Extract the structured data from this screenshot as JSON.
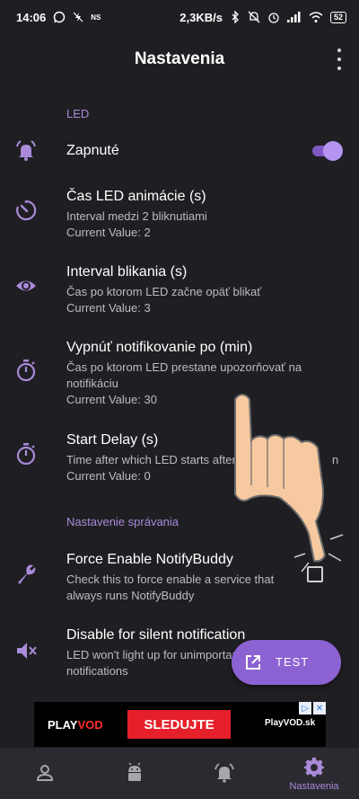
{
  "status_bar": {
    "time": "14:06",
    "left_small": "NS",
    "speed": "2,3KB/s",
    "battery": "52"
  },
  "app_bar": {
    "title": "Nastavenia"
  },
  "sections": [
    {
      "header": "LED",
      "items": [
        {
          "title": "Zapnuté",
          "icon": "alarm-bell-icon",
          "toggle_on": true
        },
        {
          "title": "Čas LED animácie (s)",
          "icon": "timer-icon",
          "summary": "Interval medzi 2 bliknutiami",
          "value": "Current Value: 2"
        },
        {
          "title": "Interval blikania (s)",
          "icon": "eye-icon",
          "summary": "Čas po ktorom LED začne opäť blikať",
          "value": "Current Value: 3"
        },
        {
          "title": "Vypnúť notifikovanie po (min)",
          "icon": "stopwatch-icon",
          "summary": "Čas po ktorom LED prestane upozorňovať na notifikáciu",
          "value": "Current Value: 30"
        },
        {
          "title": "Start Delay (s)",
          "icon": "stopwatch-icon",
          "summary": "Time after which LED starts after",
          "summary_tail": "n",
          "value": "Current Value: 0"
        }
      ]
    },
    {
      "header": "Nastavenie správania",
      "items": [
        {
          "title": "Force Enable NotifyBuddy",
          "icon": "wrench-icon",
          "summary": "Check this to force enable a service that always runs NotifyBuddy",
          "checked": false
        },
        {
          "title": "Disable for silent notification",
          "icon": "mute-icon",
          "summary": "LED won't light up for unimportant notifications"
        }
      ]
    }
  ],
  "fab": {
    "label": "TEST",
    "icon": "open-external-icon"
  },
  "ad": {
    "logo_play": "PLAY",
    "logo_vod": "VOD",
    "cta": "SLEDUJTE",
    "domain": "PlayVOD.sk"
  },
  "bottom_nav": [
    {
      "icon": "person-icon",
      "label": ""
    },
    {
      "icon": "android-icon",
      "label": ""
    },
    {
      "icon": "alarm-bell-icon",
      "label": ""
    },
    {
      "icon": "gear-icon",
      "label": "Nastavenia",
      "active": true
    }
  ],
  "colors": {
    "background": "#1f1e22",
    "accent": "#8c62d3",
    "accent_light": "#a98bd9",
    "ad_red": "#e5202a"
  }
}
